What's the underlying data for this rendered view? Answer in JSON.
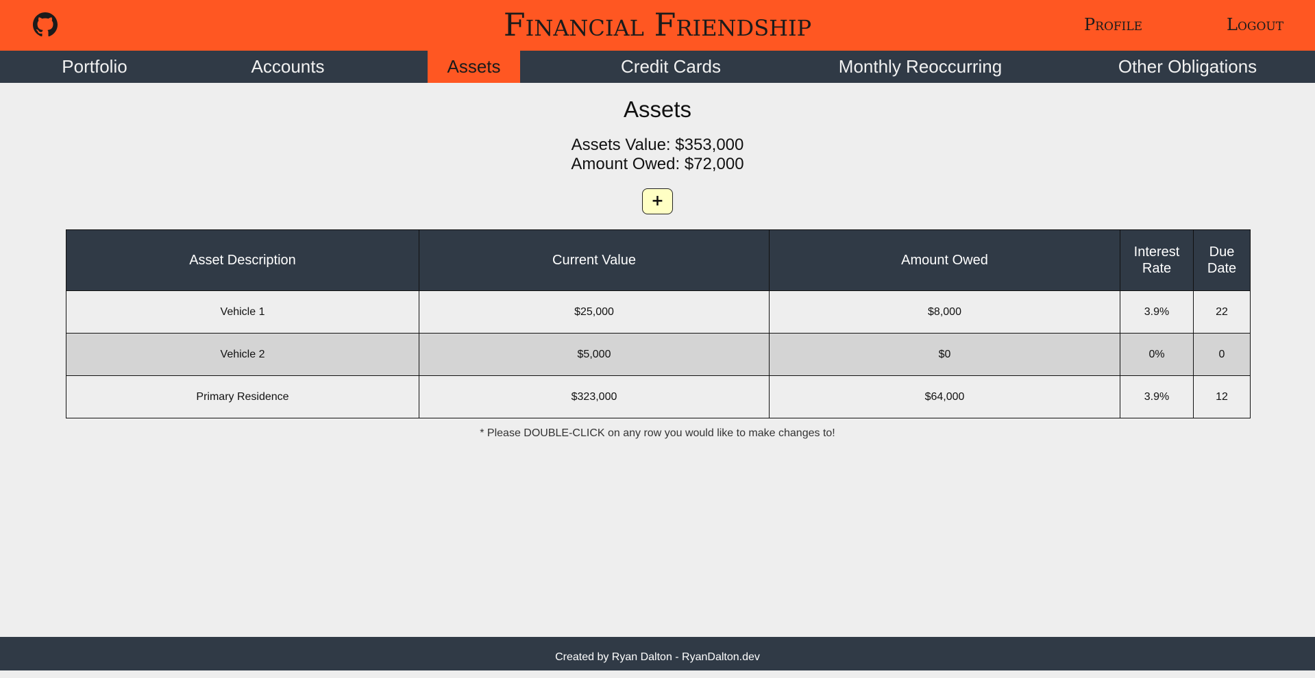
{
  "header": {
    "brand": "Financial Friendship",
    "github_icon": "github-icon",
    "links": {
      "profile": "Profile",
      "logout": "Logout"
    }
  },
  "nav": {
    "tabs": [
      {
        "label": "Portfolio"
      },
      {
        "label": "Accounts"
      },
      {
        "label": "Assets",
        "active": true
      },
      {
        "label": "Credit Cards"
      },
      {
        "label": "Monthly Reoccurring"
      },
      {
        "label": "Other Obligations"
      }
    ]
  },
  "main": {
    "title": "Assets",
    "assets_value": "Assets Value: $353,000",
    "amount_owed": "Amount Owed: $72,000",
    "add_button": "+",
    "table": {
      "headers": [
        "Asset Description",
        "Current Value",
        "Amount Owed",
        "Interest Rate",
        "Due Date"
      ],
      "rows": [
        [
          "Vehicle 1",
          "$25,000",
          "$8,000",
          "3.9%",
          "22"
        ],
        [
          "Vehicle 2",
          "$5,000",
          "$0",
          "0%",
          "0"
        ],
        [
          "Primary Residence",
          "$323,000",
          "$64,000",
          "3.9%",
          "12"
        ]
      ]
    },
    "note": "* Please DOUBLE-CLICK on any row you would like to make changes to!"
  },
  "footer": {
    "text": "Created by Ryan Dalton - RyanDalton.dev"
  },
  "colors": {
    "accent": "#ff5722",
    "dark": "#303a46",
    "background": "#eeeeee",
    "add_button": "#ffffc4",
    "row_alt": "#d4d4d4"
  }
}
